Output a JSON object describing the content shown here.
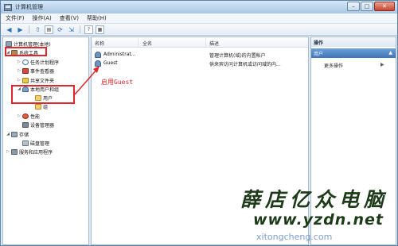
{
  "window": {
    "title": "计算机管理"
  },
  "titlebar_buttons": {
    "minimize": "–",
    "maximize": "□",
    "close": "✕"
  },
  "menubar": [
    "文件(F)",
    "操作(A)",
    "查看(V)",
    "帮助(H)"
  ],
  "toolbar": {
    "icons": [
      "back-arrow-icon",
      "forward-arrow-icon",
      "up-folder-icon",
      "show-hide-tree-icon",
      "refresh-icon",
      "export-list-icon",
      "help-icon",
      "properties-icon"
    ],
    "glyphs": {
      "back": "◀",
      "forward": "▶",
      "up": "⇧",
      "tree": "▤",
      "refresh": "⟳",
      "export": "⇲",
      "help": "?",
      "props": "▦"
    }
  },
  "tree": {
    "root": "计算机管理(本地)",
    "items": [
      {
        "label": "系统工具",
        "level": 1,
        "expanded": true,
        "icon": "tools-icon"
      },
      {
        "label": "任务计划程序",
        "level": 2,
        "icon": "clock-icon"
      },
      {
        "label": "事件查看器",
        "level": 2,
        "icon": "event-icon"
      },
      {
        "label": "共享文件夹",
        "level": 2,
        "icon": "share-icon"
      },
      {
        "label": "本地用户和组",
        "level": 2,
        "expanded": true,
        "icon": "users-icon"
      },
      {
        "label": "用户",
        "level": 3,
        "selected": true,
        "icon": "folder-icon"
      },
      {
        "label": "组",
        "level": 3,
        "icon": "folder-icon"
      },
      {
        "label": "性能",
        "level": 2,
        "icon": "perf-icon"
      },
      {
        "label": "设备管理器",
        "level": 2,
        "icon": "device-icon"
      },
      {
        "label": "存储",
        "level": 1,
        "expanded": true,
        "icon": "storage-icon"
      },
      {
        "label": "磁盘管理",
        "level": 2,
        "icon": "disk-icon"
      },
      {
        "label": "服务和应用程序",
        "level": 1,
        "icon": "services-icon"
      }
    ]
  },
  "list": {
    "columns": [
      "名称",
      "全名",
      "描述"
    ],
    "rows": [
      {
        "name": "Administrat...",
        "full_name": "",
        "description": "管理计算机(域)的内置帐户"
      },
      {
        "name": "Guest",
        "full_name": "",
        "description": "供来宾访问计算机或访问域的内..."
      }
    ]
  },
  "annotation": {
    "text": "启用Guest",
    "color": "#d8262b"
  },
  "actions": {
    "header": "操作",
    "section": "用户",
    "more": "更多操作",
    "section_arrow": "▲",
    "more_arrow": "▶"
  },
  "watermark": {
    "line1": "薛店亿众电脑",
    "line2": "www.yzdn.net",
    "line3": "xitongcheng.com"
  },
  "colors": {
    "accent": "#3f74b9",
    "highlight": "#e0262b"
  }
}
